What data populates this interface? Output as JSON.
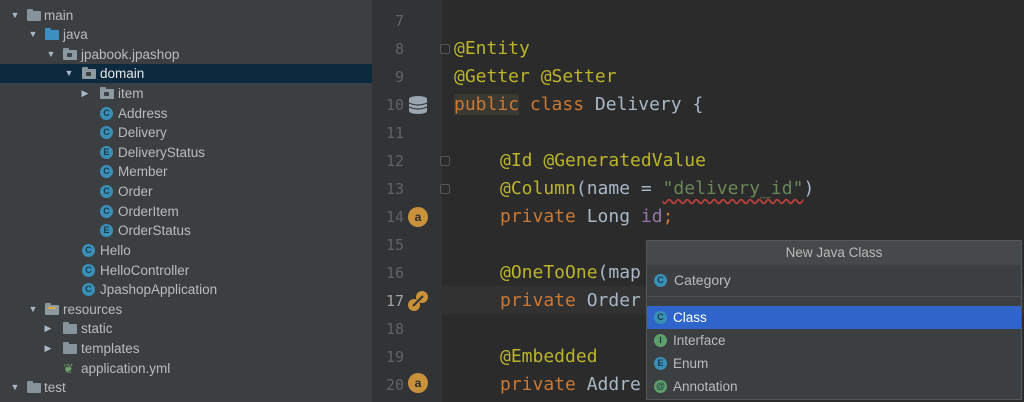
{
  "colors": {
    "tree_bg": "#3c3f41",
    "tree_selected": "#0d293e",
    "editor_bg": "#2b2b2b",
    "gutter_bg": "#313335",
    "annotation": "#bbb529",
    "keyword": "#cc7832",
    "string": "#6a8759",
    "field": "#9876aa",
    "popup_selection": "#2f65ca"
  },
  "project_tree": {
    "items": [
      {
        "label": "main",
        "icon": "folder-icon"
      },
      {
        "label": "java",
        "icon": "source-folder-icon"
      },
      {
        "label": "jpabook.jpashop",
        "icon": "package-icon"
      },
      {
        "label": "domain",
        "icon": "package-icon"
      },
      {
        "label": "item",
        "icon": "package-icon"
      },
      {
        "label": "Address",
        "icon": "class-icon",
        "glyph": "C"
      },
      {
        "label": "Delivery",
        "icon": "class-icon",
        "glyph": "C"
      },
      {
        "label": "DeliveryStatus",
        "icon": "enum-icon",
        "glyph": "E"
      },
      {
        "label": "Member",
        "icon": "class-icon",
        "glyph": "C"
      },
      {
        "label": "Order",
        "icon": "class-icon",
        "glyph": "C"
      },
      {
        "label": "OrderItem",
        "icon": "class-icon",
        "glyph": "C"
      },
      {
        "label": "OrderStatus",
        "icon": "enum-icon",
        "glyph": "E"
      },
      {
        "label": "Hello",
        "icon": "class-icon",
        "glyph": "C"
      },
      {
        "label": "HelloController",
        "icon": "class-icon",
        "glyph": "C"
      },
      {
        "label": "JpashopApplication",
        "icon": "class-icon",
        "glyph": "C"
      },
      {
        "label": "resources",
        "icon": "resources-folder-icon"
      },
      {
        "label": "static",
        "icon": "folder-icon"
      },
      {
        "label": "templates",
        "icon": "folder-icon"
      },
      {
        "label": "application.yml",
        "icon": "yml-file-icon"
      },
      {
        "label": "test",
        "icon": "folder-icon"
      }
    ]
  },
  "editor": {
    "line_numbers": [
      "7",
      "8",
      "9",
      "10",
      "11",
      "12",
      "13",
      "14",
      "15",
      "16",
      "17",
      "18",
      "19",
      "20"
    ],
    "current_line": "17",
    "lines": {
      "l8": {
        "ann": "@Entity"
      },
      "l9": {
        "ann1": "@Getter",
        "ann2": "@Setter"
      },
      "l10": {
        "kw1": "public",
        "kw2": "class",
        "name": "Delivery",
        "brace": "{"
      },
      "l12": {
        "ann1": "@Id",
        "ann2": "@GeneratedValue"
      },
      "l13": {
        "ann": "@Column",
        "open": "(name = ",
        "str": "\"delivery_id\"",
        "close": ")"
      },
      "l14": {
        "kw": "private",
        "type": "Long",
        "field": "id",
        "semi": ";"
      },
      "l16": {
        "ann": "@OneToOne",
        "rest": "(map"
      },
      "l17": {
        "kw": "private",
        "rest": "Order"
      },
      "l19": {
        "ann": "@Embedded"
      },
      "l20": {
        "kw": "private",
        "rest": "Addre"
      }
    },
    "gutter_icons": {
      "l10": "database-icon",
      "l14": "annotation-icon",
      "l17": "relation-icon",
      "l20": "annotation-icon"
    },
    "gutter_glyphs": {
      "l14": "a",
      "l20": "a"
    }
  },
  "popup": {
    "title": "New Java Class",
    "name_value": "Category",
    "name_icon_glyph": "C",
    "kinds": [
      {
        "label": "Class",
        "glyph": "C",
        "selected": true
      },
      {
        "label": "Interface",
        "glyph": "I",
        "selected": false
      },
      {
        "label": "Enum",
        "glyph": "E",
        "selected": false
      },
      {
        "label": "Annotation",
        "glyph": "@",
        "selected": false
      }
    ]
  }
}
